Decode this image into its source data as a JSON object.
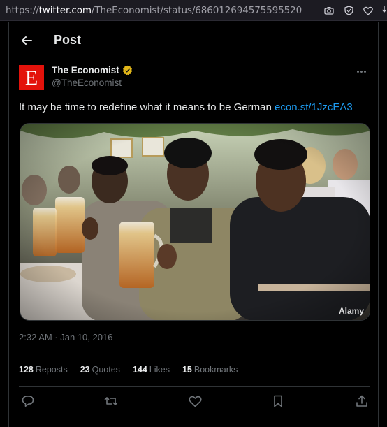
{
  "browser": {
    "url_scheme": "https://",
    "url_host": "twitter.com",
    "url_path": "/TheEconomist/status/686012694575595520"
  },
  "header": {
    "title": "Post"
  },
  "author": {
    "avatar_letter": "E",
    "name": "The Economist",
    "handle": "@TheEconomist",
    "brand_color": "#e3120b"
  },
  "post": {
    "text": "It may be time to redefine what it means to be German ",
    "link": "econ.st/1JzcEA3",
    "media_watermark": "Alamy",
    "timestamp": "2:32 AM · Jan 10, 2016"
  },
  "stats": [
    {
      "count": "128",
      "label": "Reposts"
    },
    {
      "count": "23",
      "label": "Quotes"
    },
    {
      "count": "144",
      "label": "Likes"
    },
    {
      "count": "15",
      "label": "Bookmarks"
    }
  ],
  "icons": {
    "url_bar": [
      "camera-icon",
      "shield-icon",
      "heart-outline-icon"
    ],
    "actions": [
      "reply-icon",
      "repost-icon",
      "like-icon",
      "bookmark-icon",
      "share-icon"
    ]
  },
  "colors": {
    "link": "#1d9bf0",
    "muted": "#71767b",
    "text": "#e7e9ea",
    "verified": "#e2b719"
  }
}
